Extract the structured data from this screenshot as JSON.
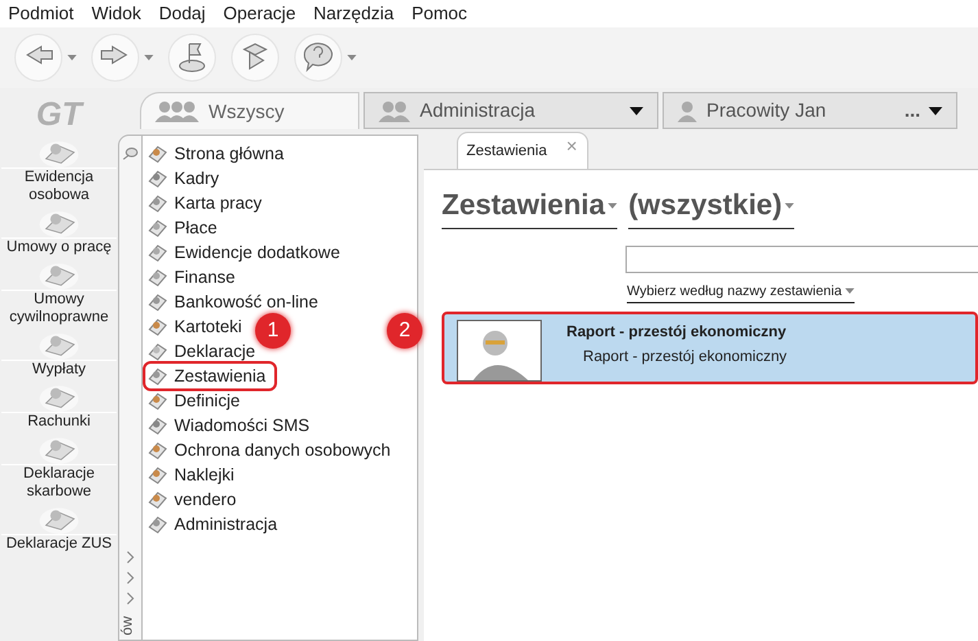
{
  "menu": [
    "Podmiot",
    "Widok",
    "Dodaj",
    "Operacje",
    "Narzędzia",
    "Pomoc"
  ],
  "toolbar": [
    {
      "kind": "back",
      "dropdown": true
    },
    {
      "kind": "forward",
      "dropdown": true
    },
    {
      "kind": "flag",
      "dropdown": false
    },
    {
      "kind": "play",
      "dropdown": false
    },
    {
      "kind": "help",
      "dropdown": true
    }
  ],
  "logo": "GT",
  "top_tabs": [
    {
      "label": "Wszyscy",
      "selected": true,
      "dropdown": false
    },
    {
      "label": "Administracja",
      "selected": false,
      "dropdown": true
    },
    {
      "label": "Pracowity Jan",
      "selected": false,
      "suffix": "...",
      "dropdown": true
    }
  ],
  "sidebar": [
    {
      "label": "Ewidencja osobowa"
    },
    {
      "label": "Umowy o pracę"
    },
    {
      "label": "Umowy cywilnoprawne"
    },
    {
      "label": "Wypłaty"
    },
    {
      "label": "Rachunki"
    },
    {
      "label": "Deklaracje skarbowe"
    },
    {
      "label": "Deklaracje ZUS"
    }
  ],
  "strip_label": "ów",
  "nav": [
    {
      "label": "Strona główna",
      "selected": false
    },
    {
      "label": "Kadry",
      "selected": false
    },
    {
      "label": "Karta pracy",
      "selected": false
    },
    {
      "label": "Płace",
      "selected": false
    },
    {
      "label": "Ewidencje dodatkowe",
      "selected": false
    },
    {
      "label": "Finanse",
      "selected": false
    },
    {
      "label": "Bankowość on-line",
      "selected": false
    },
    {
      "label": "Kartoteki",
      "selected": false
    },
    {
      "label": "Deklaracje",
      "selected": false
    },
    {
      "label": "Zestawienia",
      "selected": true
    },
    {
      "label": "Definicje",
      "selected": false
    },
    {
      "label": "Wiadomości SMS",
      "selected": false
    },
    {
      "label": "Ochrona danych osobowych",
      "selected": false
    },
    {
      "label": "Naklejki",
      "selected": false
    },
    {
      "label": "vendero",
      "selected": false
    },
    {
      "label": "Administracja",
      "selected": false
    }
  ],
  "content_tab": {
    "label": "Zestawienia",
    "close": "×"
  },
  "heading": {
    "title": "Zestawienia",
    "filter": "(wszystkie)"
  },
  "sort_link": "Wybierz według nazwy zestawienia",
  "reports": [
    {
      "title": "Raport - przestój ekonomiczny",
      "subtitle": "Raport - przestój ekonomiczny",
      "selected": true
    }
  ],
  "callouts": [
    "1",
    "2"
  ]
}
